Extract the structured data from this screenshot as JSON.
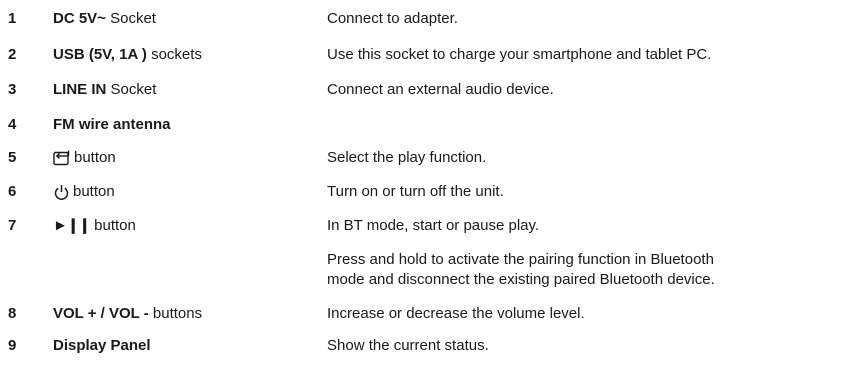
{
  "rows": [
    {
      "num": "1",
      "bold": "DC 5V~",
      "plain": " Socket",
      "desc": [
        "Connect to adapter."
      ]
    },
    {
      "num": "2",
      "bold": "USB (5V, 1A )",
      "plain": " sockets",
      "desc": [
        "Use this socket to charge your smartphone and tablet PC."
      ]
    },
    {
      "num": "3",
      "bold": "LINE IN",
      "plain": " Socket",
      "desc": [
        "Connect an external audio device."
      ]
    },
    {
      "num": "4",
      "bold": "FM wire antenna",
      "plain": "",
      "desc": []
    },
    {
      "num": "5",
      "icon": "input-source-icon",
      "plain": "button",
      "desc": [
        "Select the play function."
      ]
    },
    {
      "num": "6",
      "icon": "power-icon",
      "plain": "button",
      "desc": [
        "Turn on or turn off the unit."
      ]
    },
    {
      "num": "7",
      "icon": "play-pause-icon",
      "icon_text": "►❙❙",
      "plain": " button",
      "desc": [
        "In BT mode, start or pause play."
      ]
    },
    {
      "num": "",
      "bold": "",
      "plain": "",
      "desc": [
        "Press and hold to activate the pairing function in Bluetooth",
        "mode and disconnect the existing paired Bluetooth device."
      ]
    },
    {
      "num": "8",
      "bold": "VOL + / VOL -",
      "plain": " buttons",
      "desc": [
        "Increase or decrease the volume level."
      ]
    },
    {
      "num": "9",
      "bold": "Display Panel",
      "plain": "",
      "desc": [
        "Show the current status."
      ]
    }
  ]
}
